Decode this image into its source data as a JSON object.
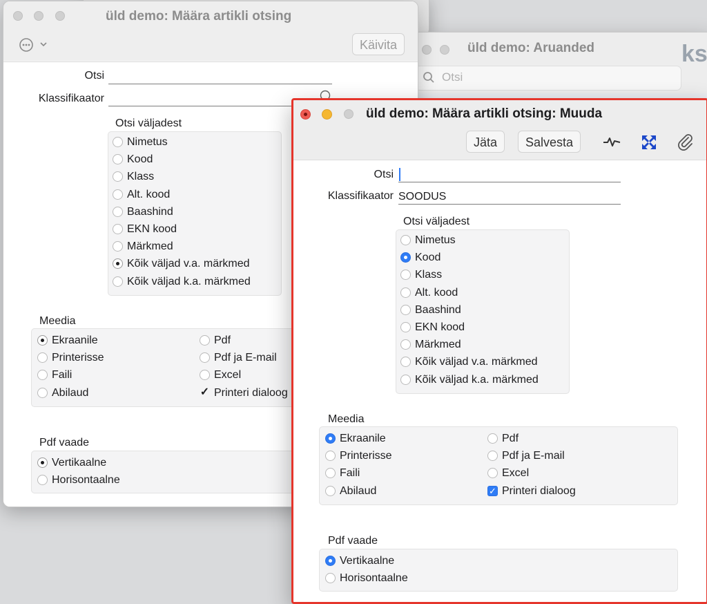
{
  "back_window": {
    "title": "üld demo: Määra artikli otsing",
    "run_button": "Käivita",
    "search_label": "Otsi",
    "class_label": "Klassifikaator",
    "fields_title": "Otsi väljadest",
    "fields": [
      "Nimetus",
      "Kood",
      "Klass",
      "Alt. kood",
      "Baashind",
      "EKN kood",
      "Märkmed",
      "Kõik väljad v.a. märkmed",
      "Kõik väljad k.a. märkmed"
    ],
    "fields_selected": 7,
    "media_title": "Meedia",
    "media_left": [
      "Ekraanile",
      "Printerisse",
      "Faili",
      "Abilaud"
    ],
    "media_right": [
      "Pdf",
      "Pdf ja E-mail",
      "Excel",
      "Printeri dialoog"
    ],
    "pdf_title": "Pdf vaade",
    "pdf_options": [
      "Vertikaalne",
      "Horisontaalne"
    ]
  },
  "middle_window": {
    "title": "üld demo: Aruanded",
    "search_placeholder": "Otsi"
  },
  "front_window": {
    "title": "üld demo: Määra artikli otsing: Muuda",
    "toolbar": {
      "discard": "Jäta",
      "save": "Salvesta"
    },
    "search_label": "Otsi",
    "search_value": "",
    "class_label": "Klassifikaator",
    "class_value": "SOODUS",
    "fields_title": "Otsi väljadest",
    "fields": [
      "Nimetus",
      "Kood",
      "Klass",
      "Alt. kood",
      "Baashind",
      "EKN kood",
      "Märkmed",
      "Kõik väljad v.a. märkmed",
      "Kõik väljad k.a. märkmed"
    ],
    "fields_selected": 1,
    "media_title": "Meedia",
    "media_left": [
      "Ekraanile",
      "Printerisse",
      "Faili",
      "Abilaud"
    ],
    "media_right": [
      "Pdf",
      "Pdf ja E-mail",
      "Excel",
      "Printeri dialoog"
    ],
    "pdf_title": "Pdf vaade",
    "pdf_options": [
      "Vertikaalne",
      "Horisontaalne"
    ]
  },
  "colors": {
    "accent": "#2f7cf6",
    "highlight_border": "#e5352b",
    "close": "#ee5b52",
    "minimize": "#f5b731"
  }
}
